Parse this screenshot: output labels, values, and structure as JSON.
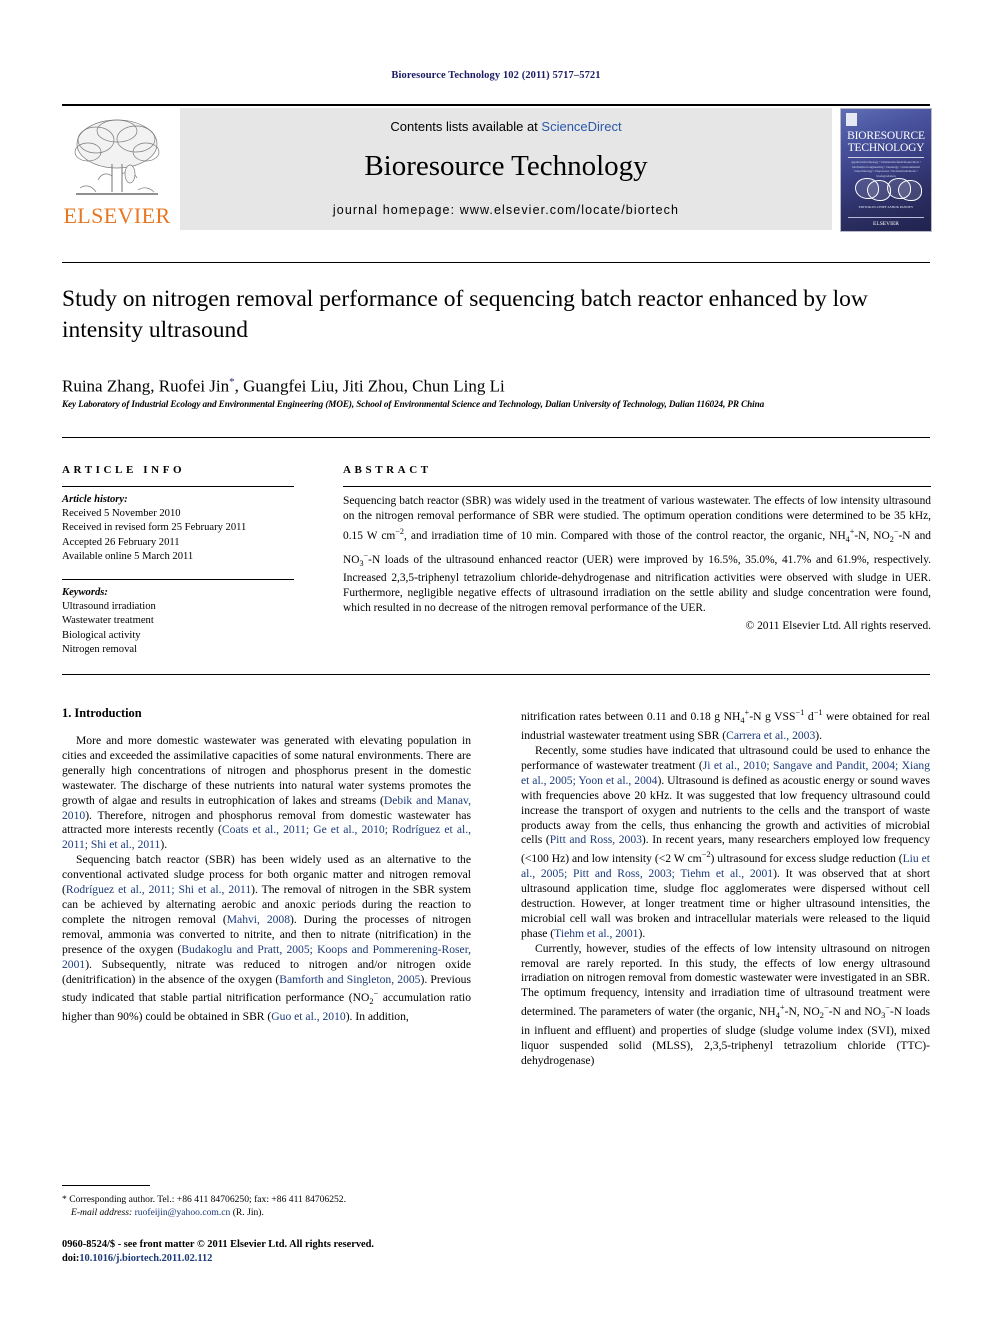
{
  "running_head": "Bioresource Technology 102 (2011) 5717–5721",
  "masthead": {
    "contents_prefix": "Contents lists available at ",
    "sciencedirect": "ScienceDirect",
    "journal_name": "Bioresource Technology",
    "homepage": "journal homepage: www.elsevier.com/locate/biortech",
    "publisher_logo_text": "ELSEVIER",
    "cover": {
      "title_line1": "BIORESOURCE",
      "title_line2": "TECHNOLOGY",
      "subtitle": "applied microbiology • biomass/biofuels/bioproducts • biochemical engineering • bioenergy • environmental biotechnology • bioprocess • biotransformations • biodegradation",
      "editors_note": "EDITOR-IN-CHIEF\nASHOK PANDEY",
      "publisher": "ELSEVIER"
    }
  },
  "article": {
    "title": "Study on nitrogen removal performance of sequencing batch reactor enhanced by low intensity ultrasound",
    "authors_pre": "Ruina Zhang, Ruofei Jin",
    "corresponding_mark": "*",
    "authors_post": ", Guangfei Liu, Jiti Zhou, Chun Ling Li",
    "affiliation": "Key Laboratory of Industrial Ecology and Environmental Engineering (MOE), School of Environmental Science and Technology, Dalian University of Technology, Dalian 116024, PR China"
  },
  "article_info": {
    "heading": "ARTICLE INFO",
    "history_label": "Article history:",
    "history": [
      "Received 5 November 2010",
      "Received in revised form 25 February 2011",
      "Accepted 26 February 2011",
      "Available online 5 March 2011"
    ],
    "keywords_label": "Keywords:",
    "keywords": [
      "Ultrasound irradiation",
      "Wastewater treatment",
      "Biological activity",
      "Nitrogen removal"
    ]
  },
  "abstract": {
    "heading": "ABSTRACT",
    "p1_a": "Sequencing batch reactor (SBR) was widely used in the treatment of various wastewater. The effects of low intensity ultrasound on the nitrogen removal performance of SBR were studied. The optimum operation conditions were determined to be 35 kHz, 0.15 W cm",
    "p1_sup1": "−2",
    "p1_b": ", and irradiation time of 10 min. Compared with those of the control reactor, the organic, NH",
    "p1_sub1": "4",
    "p1_sup2": "+",
    "p1_c": "-N, NO",
    "p1_sub2": "2",
    "p1_sup3": "−",
    "p1_d": "-N and NO",
    "p1_sub3": "3",
    "p1_sup4": "−",
    "p1_e": "-N loads of the ultrasound enhanced reactor (UER) were improved by 16.5%, 35.0%, 41.7% and 61.9%, respectively. Increased 2,3,5-triphenyl tetrazolium chloride-dehydrogenase and nitrification activities were observed with sludge in UER. Furthermore, negligible negative effects of ultrasound irradiation on the settle ability and sludge concentration were found, which resulted in no decrease of the nitrogen removal performance of the UER.",
    "copyright": "© 2011 Elsevier Ltd. All rights reserved."
  },
  "body": {
    "section1_heading": "1. Introduction",
    "left": {
      "p1_a": "More and more domestic wastewater was generated with elevating population in cities and exceeded the assimilative capacities of some natural environments. There are generally high concentrations of nitrogen and phosphorus present in the domestic wastewater. The discharge of these nutrients into natural water systems promotes the growth of algae and results in eutrophication of lakes and streams (",
      "p1_ref1": "Debik and Manav, 2010",
      "p1_b": "). Therefore, nitrogen and phosphorus removal from domestic wastewater has attracted more interests recently (",
      "p1_ref2": "Coats et al., 2011; Ge et al., 2010; Rodríguez et al., 2011; Shi et al., 2011",
      "p1_c": ").",
      "p2_a": "Sequencing batch reactor (SBR) has been widely used as an alternative to the conventional activated sludge process for both organic matter and nitrogen removal (",
      "p2_ref1": "Rodríguez et al., 2011; Shi et al., 2011",
      "p2_b": "). The removal of nitrogen in the SBR system can be achieved by alternating aerobic and anoxic periods during the reaction to complete the nitrogen removal (",
      "p2_ref2": "Mahvi, 2008",
      "p2_c": "). During the processes of nitrogen removal, ammonia was converted to nitrite, and then to nitrate (nitrification) in the presence of the oxygen (",
      "p2_ref3": "Budakoglu and Pratt, 2005; Koops and Pommerening-Roser, 2001",
      "p2_d": "). Subsequently, nitrate was reduced to nitrogen and/or nitrogen oxide (denitrification) in the absence of the oxygen (",
      "p2_ref4": "Bamforth and Singleton, 2005",
      "p2_e": "). Previous study indicated that stable partial nitrification performance (NO",
      "p2_sub1": "2",
      "p2_sup1": "−",
      "p2_f": " accumulation ratio higher than 90%) could be obtained in SBR (",
      "p2_ref5": "Guo et al., 2010",
      "p2_g": "). In addition,"
    },
    "right": {
      "p1_a": "nitrification rates between 0.11 and 0.18 g NH",
      "p1_sub1": "4",
      "p1_sup1": "+",
      "p1_b": "-N g VSS",
      "p1_sup2": "−1",
      "p1_c": " d",
      "p1_sup3": "−1",
      "p1_d": " were obtained for real industrial wastewater treatment using SBR (",
      "p1_ref1": "Carrera et al., 2003",
      "p1_e": ").",
      "p2_a": "Recently, some studies have indicated that ultrasound could be used to enhance the performance of wastewater treatment (",
      "p2_ref1": "Ji et al., 2010; Sangave and Pandit, 2004; Xiang et al., 2005; Yoon et al., 2004",
      "p2_b": "). Ultrasound is defined as acoustic energy or sound waves with frequencies above 20 kHz. It was suggested that low frequency ultrasound could increase the transport of oxygen and nutrients to the cells and the transport of waste products away from the cells, thus enhancing the growth and activities of microbial cells (",
      "p2_ref2": "Pitt and Ross, 2003",
      "p2_c": "). In recent years, many researchers employed low frequency (<100 Hz) and low intensity (<2 W cm",
      "p2_sup1": "−2",
      "p2_d": ") ultrasound for excess sludge reduction (",
      "p2_ref3": "Liu et al., 2005; Pitt and Ross, 2003; Tiehm et al., 2001",
      "p2_e": "). It was observed that at short ultrasound application time, sludge floc agglomerates were dispersed without cell destruction. However, at longer treatment time or higher ultrasound intensities, the microbial cell wall was broken and intracellular materials were released to the liquid phase (",
      "p2_ref4": "Tiehm et al., 2001",
      "p2_f": ").",
      "p3_a": "Currently, however, studies of the effects of low intensity ultrasound on nitrogen removal are rarely reported. In this study, the effects of low energy ultrasound irradiation on nitrogen removal from domestic wastewater were investigated in an SBR. The optimum frequency, intensity and irradiation time of ultrasound treatment were determined. The parameters of water (the organic, NH",
      "p3_sub1": "4",
      "p3_sup1": "+",
      "p3_b": "-N, NO",
      "p3_sub2": "2",
      "p3_sup2": "−",
      "p3_c": "-N and NO",
      "p3_sub3": "3",
      "p3_sup3": "−",
      "p3_d": "-N loads in influent and effluent) and properties of sludge (sludge volume index (SVI), mixed liquor suspended solid (MLSS), 2,3,5-triphenyl tetrazolium chloride (TTC)-dehydrogenase)"
    }
  },
  "footnote": {
    "mark": "*",
    "corresponding": "Corresponding author. Tel.: +86 411 84706250; fax: +86 411 84706252.",
    "email_label": "E-mail address:",
    "email": "ruofeijin@yahoo.com.cn",
    "email_suffix": "(R. Jin)."
  },
  "issn_block": {
    "line1": "0960-8524/$ - see front matter © 2011 Elsevier Ltd. All rights reserved.",
    "doi_label": "doi:",
    "doi": "10.1016/j.biortech.2011.02.112"
  },
  "colors": {
    "link": "#1b3a7a",
    "sciencedirect": "#2b57a8",
    "elsevier_orange": "#E87722",
    "runhead_navy": "#1b1b64"
  }
}
